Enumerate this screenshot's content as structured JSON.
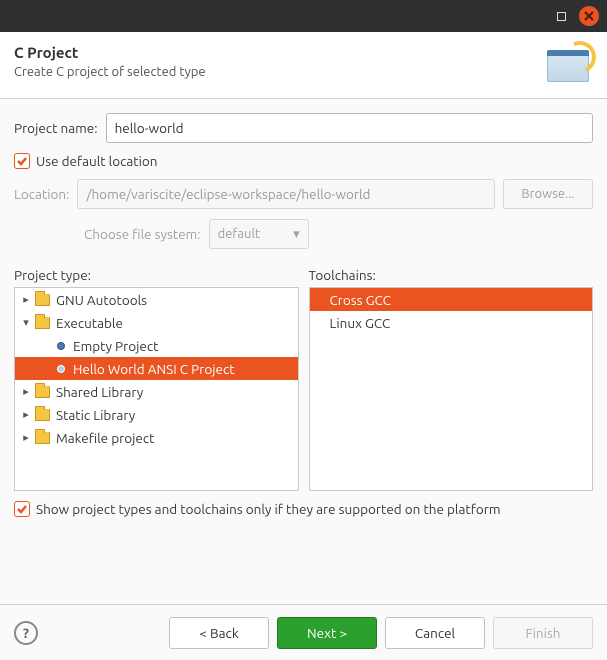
{
  "header": {
    "title": "C Project",
    "subtitle": "Create C project of selected type"
  },
  "project_name": {
    "label": "Project name:",
    "value": "hello-world"
  },
  "use_default_location": {
    "label": "Use default location",
    "checked": true
  },
  "location": {
    "label": "Location:",
    "value": "/home/variscite/eclipse-workspace/hello-world",
    "browse_label": "Browse..."
  },
  "file_system": {
    "label": "Choose file system:",
    "value": "default"
  },
  "project_type": {
    "label": "Project type:",
    "items": [
      {
        "label": "GNU Autotools",
        "expanded": false,
        "children": []
      },
      {
        "label": "Executable",
        "expanded": true,
        "children": [
          {
            "label": "Empty Project",
            "selected": false
          },
          {
            "label": "Hello World ANSI C Project",
            "selected": true
          }
        ]
      },
      {
        "label": "Shared Library",
        "expanded": false,
        "children": []
      },
      {
        "label": "Static Library",
        "expanded": false,
        "children": []
      },
      {
        "label": "Makefile project",
        "expanded": false,
        "children": []
      }
    ]
  },
  "toolchains": {
    "label": "Toolchains:",
    "items": [
      {
        "label": "Cross GCC",
        "selected": true
      },
      {
        "label": "Linux GCC",
        "selected": false
      }
    ]
  },
  "filter": {
    "label": "Show project types and toolchains only if they are supported on the platform",
    "checked": true
  },
  "buttons": {
    "back": "< Back",
    "next": "Next >",
    "cancel": "Cancel",
    "finish": "Finish",
    "help": "?"
  }
}
